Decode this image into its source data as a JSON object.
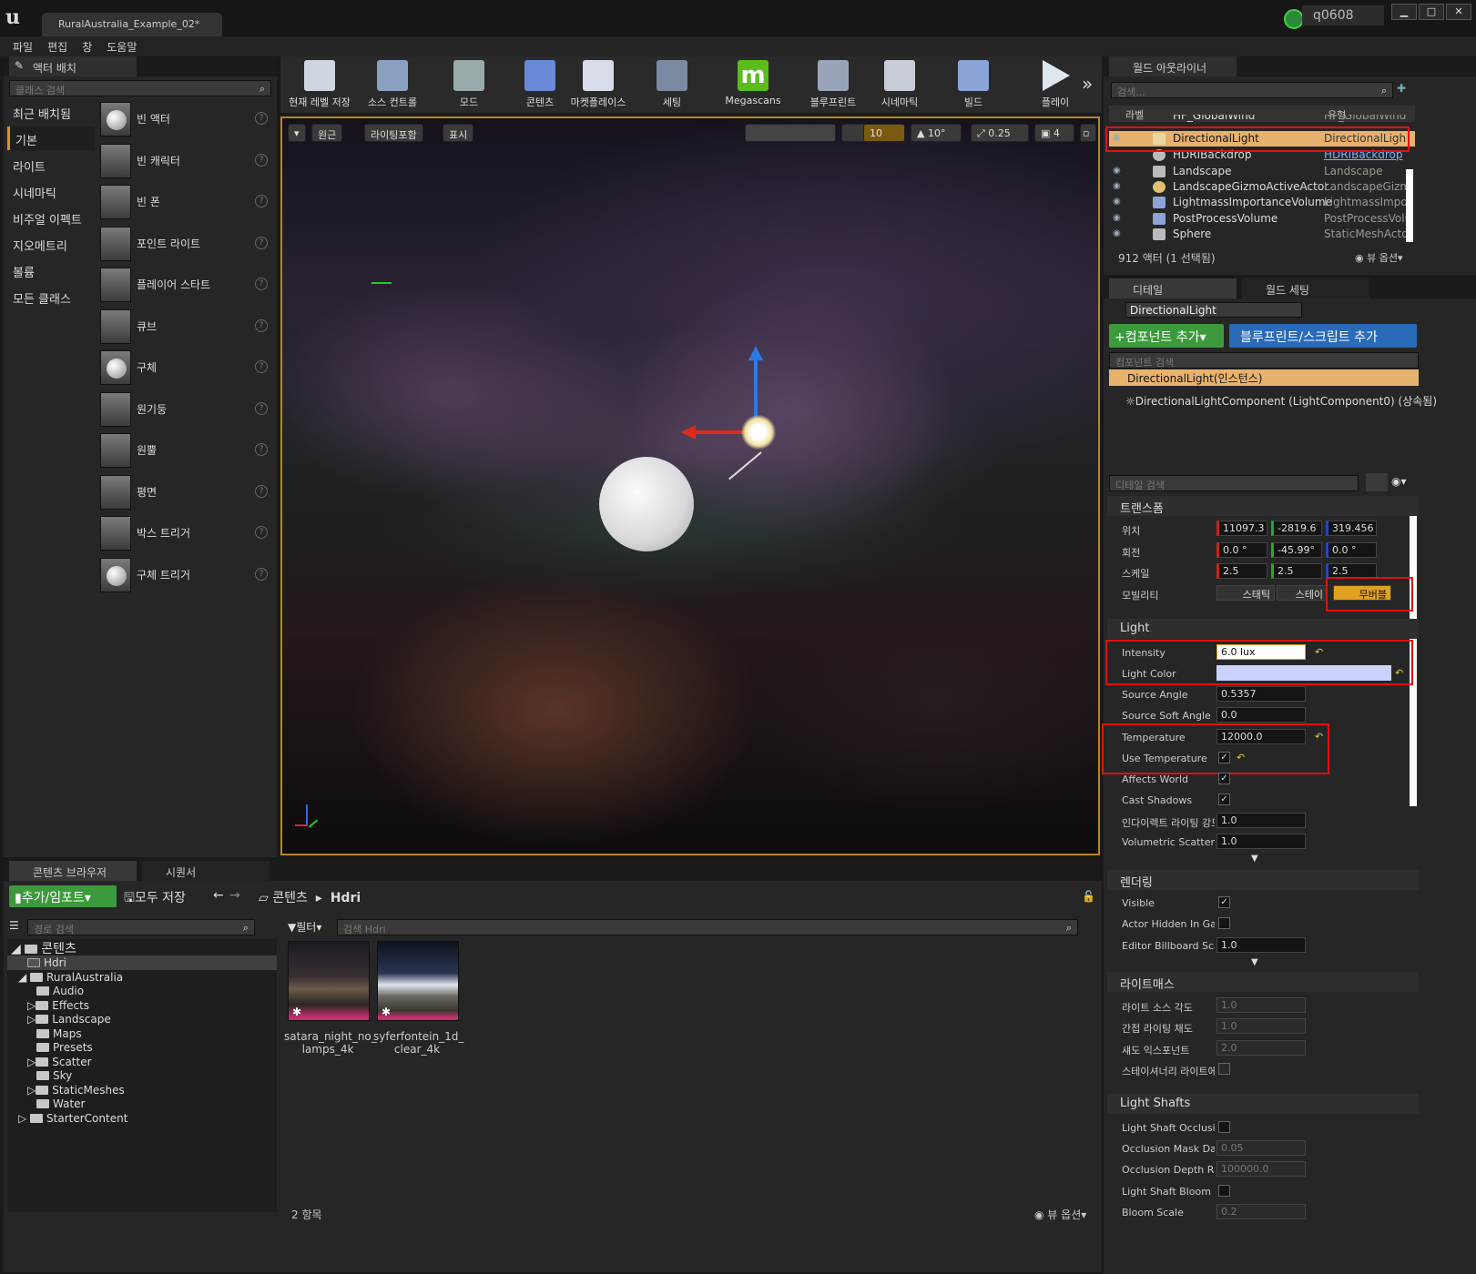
{
  "title_tab": "RuralAustralia_Example_02",
  "user": "q0608",
  "window_buttons": [
    "▁",
    "□",
    "✕"
  ],
  "menu": [
    "파일",
    "편집",
    "창",
    "도움말"
  ],
  "place_actors": {
    "tab": "액터 배치",
    "search_placeholder": "클래스 검색",
    "categories": [
      "최근 배치됨",
      "기본",
      "라이트",
      "시네마틱",
      "비주얼 이펙트",
      "지오메트리",
      "볼륨",
      "모든 클래스"
    ],
    "items": [
      "빈 액터",
      "빈 캐릭터",
      "빈 폰",
      "포인트 라이트",
      "플레이어 스타트",
      "큐브",
      "구체",
      "원기둥",
      "원뿔",
      "평면",
      "박스 트리거",
      "구체 트리거"
    ]
  },
  "toolbar": [
    "현재 레벨 저장",
    "소스 컨트롤",
    "모드",
    "콘텐츠",
    "마켓플레이스",
    "세팅",
    "Megascans",
    "블루프린트",
    "시네마틱",
    "빌드",
    "플레이"
  ],
  "viewport": {
    "perspective": "원근",
    "lighting": "라이팅포함",
    "show": "표시",
    "grid": "10",
    "rot": "10°",
    "scale": "0.25",
    "cam": "4"
  },
  "outliner": {
    "tab": "월드 아웃라이너",
    "search_placeholder": "검색...",
    "col_label": "라벨",
    "col_type": "유형",
    "rows": [
      {
        "name": "HF_GlobalWind",
        "type": "HF_GlobalWind"
      },
      {
        "name": "DirectionalLight",
        "type": "DirectionalLight"
      },
      {
        "name": "HDRIBackdrop",
        "type": "HDRIBackdrop"
      },
      {
        "name": "Landscape",
        "type": "Landscape"
      },
      {
        "name": "LandscapeGizmoActiveActor",
        "type": "LandscapeGizmo"
      },
      {
        "name": "LightmassImportanceVolume",
        "type": "LightmassImport"
      },
      {
        "name": "PostProcessVolume",
        "type": "PostProcessVolu"
      },
      {
        "name": "Sphere",
        "type": "StaticMeshActor"
      }
    ],
    "count": "912 액터 (1 선택됨)",
    "view_options": "뷰 옵션"
  },
  "details": {
    "tab": "디테일",
    "tab2": "월드 세팅",
    "actor_name": "DirectionalLight",
    "add_component": "+컴포넌트 추가",
    "add_bp": "블루프린트/스크립트 추가",
    "comp_search": "컴포넌트 검색",
    "instance": "DirectionalLight(인스턴스)",
    "component": "DirectionalLightComponent (LightComponent0) (상속됨)",
    "detail_search": "디테일 검색",
    "transform": "트랜스폼",
    "location_label": "위치",
    "location": [
      "11097.3",
      "-2819.6",
      "319.456"
    ],
    "rotation_label": "회전",
    "rotation": [
      "0.0 °",
      "-45.99°",
      "0.0 °"
    ],
    "scale_label": "스케일",
    "scale": [
      "2.5",
      "2.5",
      "2.5"
    ],
    "mobility_label": "모빌리티",
    "mobility": [
      "스태틱",
      "스테이",
      "무버블"
    ],
    "light": "Light",
    "intensity_label": "Intensity",
    "intensity": "6.0 lux",
    "light_color_label": "Light Color",
    "source_angle_label": "Source Angle",
    "source_angle": "0.5357",
    "source_soft_label": "Source Soft Angle",
    "source_soft": "0.0",
    "temperature_label": "Temperature",
    "temperature": "12000.0",
    "use_temp_label": "Use Temperature",
    "affects_world_label": "Affects World",
    "cast_shadows_label": "Cast Shadows",
    "indirect_label": "인다이렉트 라이팅 강도",
    "indirect": "1.0",
    "volumetric_label": "Volumetric Scatterin",
    "volumetric": "1.0",
    "rendering": "렌더링",
    "visible_label": "Visible",
    "actor_hidden_label": "Actor Hidden In Gam",
    "billboard_label": "Editor Billboard Scale",
    "billboard": "1.0",
    "lightmass": "라이트매스",
    "lm_source_label": "라이트 소스 각도",
    "lm_source": "1.0",
    "lm_indirect_label": "간접 라이팅 채도",
    "lm_indirect": "1.0",
    "lm_shadow_label": "섀도 익스포넌트",
    "lm_shadow": "2.0",
    "lm_stationary_label": "스테이셔너리 라이트에",
    "shafts": "Light Shafts",
    "occlusion_label": "Light Shaft Occlusio",
    "mask_label": "Occlusion Mask Darl",
    "mask": "0.05",
    "depth_label": "Occlusion Depth Ran",
    "depth": "100000.0",
    "bloom_label": "Light Shaft Bloom",
    "bloom_scale_label": "Bloom Scale",
    "bloom_scale": "0.2"
  },
  "content_browser": {
    "tab": "콘텐츠 브라우저",
    "tab2": "시퀀서",
    "add_import": "추가/임포트",
    "save_all": "모두 저장",
    "path_root": "콘텐츠",
    "path_child": "Hdri",
    "path_search": "경로 검색",
    "filter": "필터",
    "asset_search": "검색 Hdri",
    "tree": [
      "콘텐츠",
      "Hdri",
      "RuralAustralia",
      "Audio",
      "Effects",
      "Landscape",
      "Maps",
      "Presets",
      "Scatter",
      "Sky",
      "StaticMeshes",
      "Water",
      "StarterContent"
    ],
    "assets": [
      "satara_night_no_\nlamps_4k",
      "syferfontein_1d_\nclear_4k"
    ],
    "count": "2 항목",
    "view_options": "뷰 옵션"
  }
}
